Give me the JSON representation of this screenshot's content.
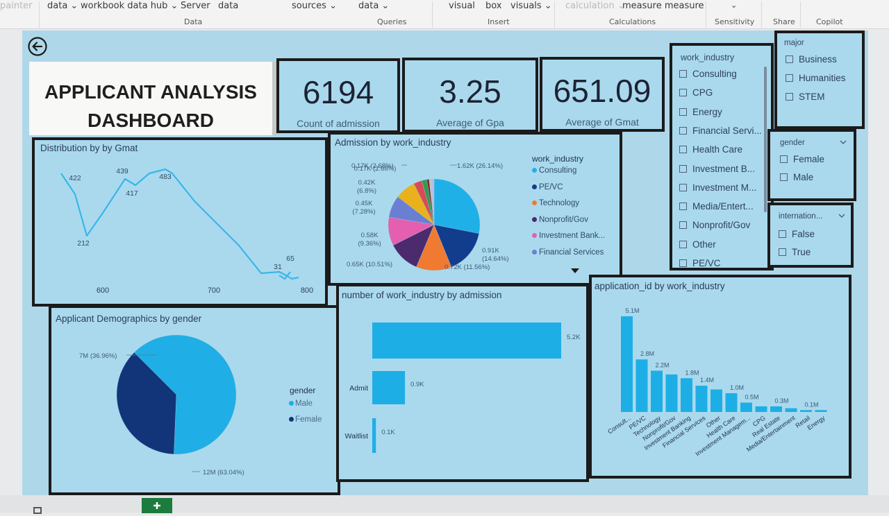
{
  "ribbon": {
    "items": [
      "painter",
      "data ⌄",
      "workbook data hub ⌄",
      "Server",
      "data",
      "sources ⌄",
      "data ⌄",
      "visual",
      "box",
      "visuals ⌄",
      "calculation ⌄",
      "measure measure",
      "⌄"
    ],
    "groups": [
      "Data",
      "Queries",
      "Insert",
      "Calculations",
      "Sensitivity",
      "Share",
      "Copilot"
    ]
  },
  "dashboard": {
    "title_line1": "APPLICANT ANALYSIS",
    "title_line2": "DASHBOARD",
    "kpis": [
      {
        "value": "6194",
        "label": "Count of admission"
      },
      {
        "value": "3.25",
        "label": "Average of Gpa"
      },
      {
        "value": "651.09",
        "label": "Average of Gmat"
      }
    ]
  },
  "slicers": {
    "work_industry": {
      "title": "work_industry",
      "items": [
        "Consulting",
        "CPG",
        "Energy",
        "Financial Servi...",
        "Health Care",
        "Investment B...",
        "Investment M...",
        "Media/Entert...",
        "Nonprofit/Gov",
        "Other",
        "PE/VC"
      ]
    },
    "major": {
      "title": "major",
      "items": [
        "Business",
        "Humanities",
        "STEM"
      ]
    },
    "gender": {
      "title": "gender",
      "items": [
        "Female",
        "Male"
      ]
    },
    "international": {
      "title": "internation...",
      "items": [
        "False",
        "True"
      ]
    }
  },
  "colors": {
    "panel": "#aad9ee",
    "canvas": "#aed7ea",
    "line": "#38b6e8",
    "bar": "#1eaee6",
    "male": "#1faee6",
    "female": "#12357a",
    "border": "#1b1b1b"
  },
  "chart_data": [
    {
      "type": "line",
      "title": "Distribution by by Gmat",
      "x_ticks": [
        "600",
        "700",
        "800"
      ],
      "point_labels": [
        "422",
        "212",
        "439",
        "417",
        "483",
        "31",
        "65"
      ],
      "grid": false
    },
    {
      "type": "pie",
      "title": "Admission by work_industry",
      "legend_title": "work_industry",
      "legend": [
        "Consulting",
        "PE/VC",
        "Technology",
        "Nonprofit/Gov",
        "Investment Bank...",
        "Financial Services"
      ],
      "legend_colors": [
        "#1fb0e8",
        "#123d8c",
        "#f07a32",
        "#4b2a6e",
        "#e45fb0",
        "#6a7fd2"
      ],
      "slices": [
        {
          "name": "Consulting",
          "value": 1.62,
          "label": "1.62K (26.14%)",
          "color": "#1fb0e8"
        },
        {
          "name": "PE/VC",
          "value": 0.91,
          "label": "0.91K (14.64%)",
          "color": "#123d8c"
        },
        {
          "name": "Technology",
          "value": 0.72,
          "label": "0.72K (11.56%)",
          "color": "#f07a32"
        },
        {
          "name": "Nonprofit/Gov",
          "value": 0.65,
          "label": "0.65K (10.51%)",
          "color": "#4b2a6e"
        },
        {
          "name": "Investment Banking",
          "value": 0.58,
          "label": "0.58K (9.36%)",
          "color": "#e45fb0"
        },
        {
          "name": "Financial Services",
          "value": 0.45,
          "label": "0.45K (7.28%)",
          "color": "#6a7fd2"
        },
        {
          "name": "Health Care",
          "value": 0.42,
          "label": "0.42K (6.8%)",
          "color": "#e9b21c"
        },
        {
          "name": "Other",
          "value": 0.17,
          "label": "0.17K (2.68%)",
          "color": "#d84b55"
        },
        {
          "name": "CPG",
          "value": 0.1,
          "label": "",
          "color": "#2f9a51"
        },
        {
          "name": "Real Estate",
          "value": 0.05,
          "label": "",
          "color": "#7a2e2e"
        },
        {
          "name": "Media/Entertainment",
          "value": 0.04,
          "label": "",
          "color": "#c6c6c6"
        },
        {
          "name": "Retail",
          "value": 0.03,
          "label": "",
          "color": "#d6b0e0"
        },
        {
          "name": "Energy",
          "value": 0.03,
          "label": "",
          "color": "#8bd3f0"
        }
      ]
    },
    {
      "type": "pie",
      "title": "Applicant Demographics by gender",
      "legend_title": "gender",
      "legend": [
        "Male",
        "Female"
      ],
      "slices": [
        {
          "name": "Male",
          "value": 12,
          "label": "12M (63.04%)",
          "color": "#1faee6"
        },
        {
          "name": "Female",
          "value": 7,
          "label": "7M (36.96%)",
          "color": "#12357a"
        }
      ]
    },
    {
      "type": "bar",
      "orientation": "horizontal",
      "title": "number of work_industry by admission",
      "categories": [
        "",
        "Admit",
        "Waitlist"
      ],
      "values": [
        5.2,
        0.9,
        0.1
      ],
      "labels": [
        "5.2K",
        "0.9K",
        "0.1K"
      ]
    },
    {
      "type": "bar",
      "title": "application_id by work_industry",
      "categories": [
        "Consult...",
        "PE/VC",
        "Technology",
        "Nonprofit/Gov",
        "Investment Banking",
        "Financial Services",
        "Other",
        "Health Care",
        "Investment Managem...",
        "CPG",
        "Real Estate",
        "Media/Entertainment",
        "Retail",
        "Energy"
      ],
      "values": [
        5.1,
        2.8,
        2.2,
        2.0,
        1.8,
        1.4,
        1.2,
        1.0,
        0.5,
        0.3,
        0.3,
        0.2,
        0.1,
        0.1
      ],
      "labels": [
        "5.1M",
        "2.8M",
        "2.2M",
        "",
        "1.8M",
        "1.4M",
        "",
        "1.0M",
        "0.5M",
        "",
        "0.3M",
        "",
        "0.1M",
        ""
      ]
    }
  ]
}
